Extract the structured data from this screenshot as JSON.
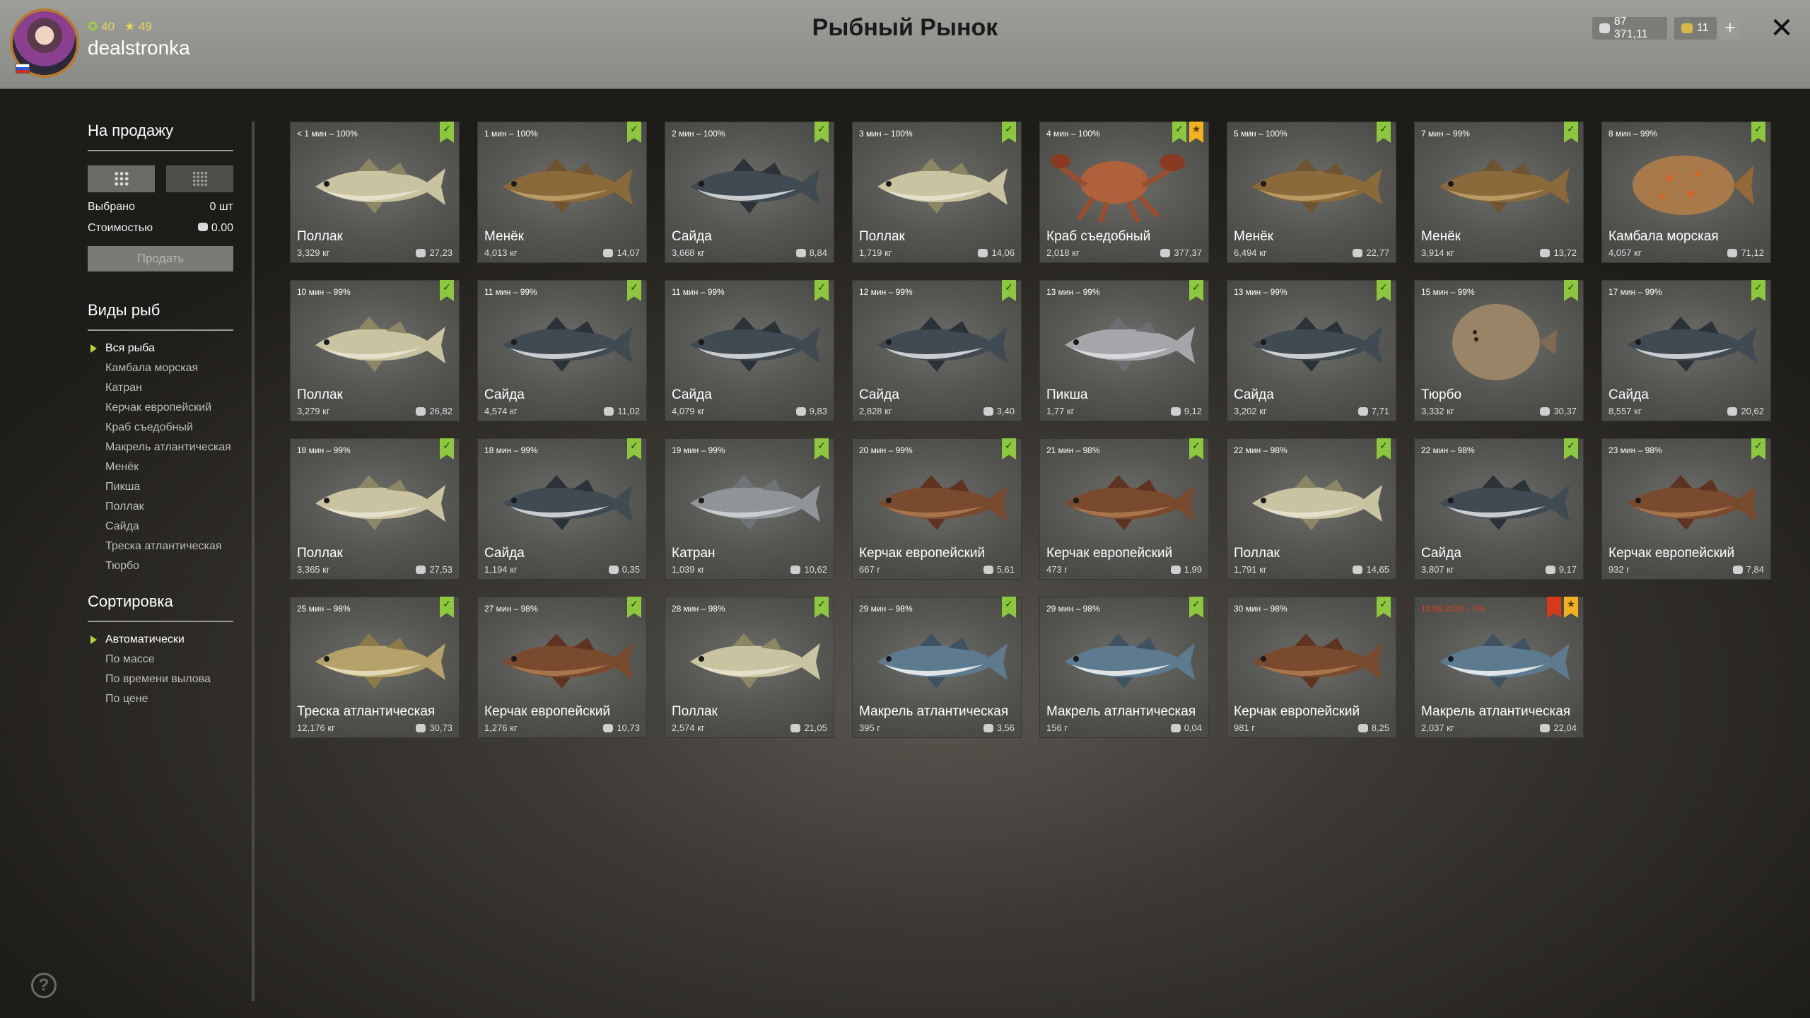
{
  "header": {
    "title": "Рыбный Рынок",
    "user": {
      "stat_a": "40",
      "stat_b": "49",
      "username": "dealstronka"
    },
    "silver": "87 371,11",
    "gold": "11",
    "plus": "+",
    "close": "✕"
  },
  "sidebar": {
    "sale_title": "На продажу",
    "selected_label": "Выбрано",
    "selected_value": "0 шт",
    "cost_label": "Стоимостью",
    "cost_value": "0.00",
    "sell_button": "Продать",
    "species_title": "Виды рыб",
    "species": [
      "Вся рыба",
      "Камбала морская",
      "Катран",
      "Керчак европейский",
      "Краб съедобный",
      "Макрель атлантическая",
      "Менёк",
      "Пикша",
      "Поллак",
      "Сайда",
      "Треска атлантическая",
      "Тюрбо"
    ],
    "sort_title": "Сортировка",
    "sort": [
      "Автоматически",
      "По массе",
      "По времени вылова",
      "По цене"
    ],
    "help": "?"
  },
  "colors": {
    "check_flag": "#8dc63f",
    "star_flag": "#f2b120",
    "red_flag": "#d63a1a",
    "expired_text": "#e04020",
    "active_marker": "#b7d43a"
  },
  "cards": [
    {
      "time": "< 1 мин – 100%",
      "name": "Поллак",
      "weight": "3,329 кг",
      "price": "27,23",
      "kind": "pollock",
      "flags": [
        "check"
      ]
    },
    {
      "time": "1 мин – 100%",
      "name": "Менёк",
      "weight": "4,013 кг",
      "price": "14,07",
      "kind": "tusk",
      "flags": [
        "check"
      ]
    },
    {
      "time": "2 мин – 100%",
      "name": "Сайда",
      "weight": "3,668 кг",
      "price": "8,84",
      "kind": "saithe",
      "flags": [
        "check"
      ]
    },
    {
      "time": "3 мин – 100%",
      "name": "Поллак",
      "weight": "1,719 кг",
      "price": "14,06",
      "kind": "pollock",
      "flags": [
        "check"
      ]
    },
    {
      "time": "4 мин – 100%",
      "name": "Краб съедобный",
      "weight": "2,018 кг",
      "price": "377,37",
      "kind": "crab",
      "flags": [
        "check",
        "star"
      ]
    },
    {
      "time": "5 мин – 100%",
      "name": "Менёк",
      "weight": "6,494 кг",
      "price": "22,77",
      "kind": "tusk",
      "flags": [
        "check"
      ]
    },
    {
      "time": "7 мин – 99%",
      "name": "Менёк",
      "weight": "3,914 кг",
      "price": "13,72",
      "kind": "tusk",
      "flags": [
        "check"
      ]
    },
    {
      "time": "8 мин – 99%",
      "name": "Камбала морская",
      "weight": "4,057 кг",
      "price": "71,12",
      "kind": "plaice",
      "flags": [
        "check"
      ]
    },
    {
      "time": "10 мин – 99%",
      "name": "Поллак",
      "weight": "3,279 кг",
      "price": "26,82",
      "kind": "pollock",
      "flags": [
        "check"
      ]
    },
    {
      "time": "11 мин – 99%",
      "name": "Сайда",
      "weight": "4,574 кг",
      "price": "11,02",
      "kind": "saithe",
      "flags": [
        "check"
      ]
    },
    {
      "time": "11 мин – 99%",
      "name": "Сайда",
      "weight": "4,079 кг",
      "price": "9,83",
      "kind": "saithe",
      "flags": [
        "check"
      ]
    },
    {
      "time": "12 мин – 99%",
      "name": "Сайда",
      "weight": "2,828 кг",
      "price": "3,40",
      "kind": "saithe",
      "flags": [
        "check"
      ]
    },
    {
      "time": "13 мин – 99%",
      "name": "Пикша",
      "weight": "1,77 кг",
      "price": "9,12",
      "kind": "haddock",
      "flags": [
        "check"
      ]
    },
    {
      "time": "13 мин – 99%",
      "name": "Сайда",
      "weight": "3,202 кг",
      "price": "7,71",
      "kind": "saithe",
      "flags": [
        "check"
      ]
    },
    {
      "time": "15 мин – 99%",
      "name": "Тюрбо",
      "weight": "3,332 кг",
      "price": "30,37",
      "kind": "turbot",
      "flags": [
        "check"
      ]
    },
    {
      "time": "17 мин – 99%",
      "name": "Сайда",
      "weight": "8,557 кг",
      "price": "20,62",
      "kind": "saithe",
      "flags": [
        "check"
      ]
    },
    {
      "time": "18 мин – 99%",
      "name": "Поллак",
      "weight": "3,365 кг",
      "price": "27,53",
      "kind": "pollock",
      "flags": [
        "check"
      ]
    },
    {
      "time": "18 мин – 99%",
      "name": "Сайда",
      "weight": "1,194 кг",
      "price": "0,35",
      "kind": "saithe",
      "flags": [
        "check"
      ]
    },
    {
      "time": "19 мин – 99%",
      "name": "Катран",
      "weight": "1,039 кг",
      "price": "10,62",
      "kind": "dogfish",
      "flags": [
        "check"
      ]
    },
    {
      "time": "20 мин – 99%",
      "name": "Керчак европейский",
      "weight": "667 г",
      "price": "5,61",
      "kind": "sculpin",
      "flags": [
        "check"
      ]
    },
    {
      "time": "21 мин – 98%",
      "name": "Керчак европейский",
      "weight": "473 г",
      "price": "1,99",
      "kind": "sculpin",
      "flags": [
        "check"
      ]
    },
    {
      "time": "22 мин – 98%",
      "name": "Поллак",
      "weight": "1,791 кг",
      "price": "14,65",
      "kind": "pollock",
      "flags": [
        "check"
      ]
    },
    {
      "time": "22 мин – 98%",
      "name": "Сайда",
      "weight": "3,807 кг",
      "price": "9,17",
      "kind": "saithe",
      "flags": [
        "check"
      ]
    },
    {
      "time": "23 мин – 98%",
      "name": "Керчак европейский",
      "weight": "932 г",
      "price": "7,84",
      "kind": "sculpin",
      "flags": [
        "check"
      ]
    },
    {
      "time": "25 мин – 98%",
      "name": "Треска атлантическая",
      "weight": "12,176 кг",
      "price": "30,73",
      "kind": "cod",
      "flags": [
        "check"
      ]
    },
    {
      "time": "27 мин – 98%",
      "name": "Керчак европейский",
      "weight": "1,276 кг",
      "price": "10,73",
      "kind": "sculpin",
      "flags": [
        "check"
      ]
    },
    {
      "time": "28 мин – 98%",
      "name": "Поллак",
      "weight": "2,574 кг",
      "price": "21,05",
      "kind": "pollock",
      "flags": [
        "check"
      ]
    },
    {
      "time": "29 мин – 98%",
      "name": "Макрель атлантическая",
      "weight": "395 г",
      "price": "3,56",
      "kind": "mackerel",
      "flags": [
        "check"
      ]
    },
    {
      "time": "29 мин – 98%",
      "name": "Макрель атлантическая",
      "weight": "156 г",
      "price": "0,04",
      "kind": "mackerel",
      "flags": [
        "check"
      ]
    },
    {
      "time": "30 мин – 98%",
      "name": "Керчак европейский",
      "weight": "981 г",
      "price": "8,25",
      "kind": "sculpin",
      "flags": [
        "check"
      ]
    },
    {
      "time": "10.08.2025 – 0%",
      "name": "Макрель атлантическая",
      "weight": "2,037 кг",
      "price": "22,04",
      "kind": "mackerel",
      "flags": [
        "red",
        "star"
      ],
      "expired": true
    }
  ]
}
